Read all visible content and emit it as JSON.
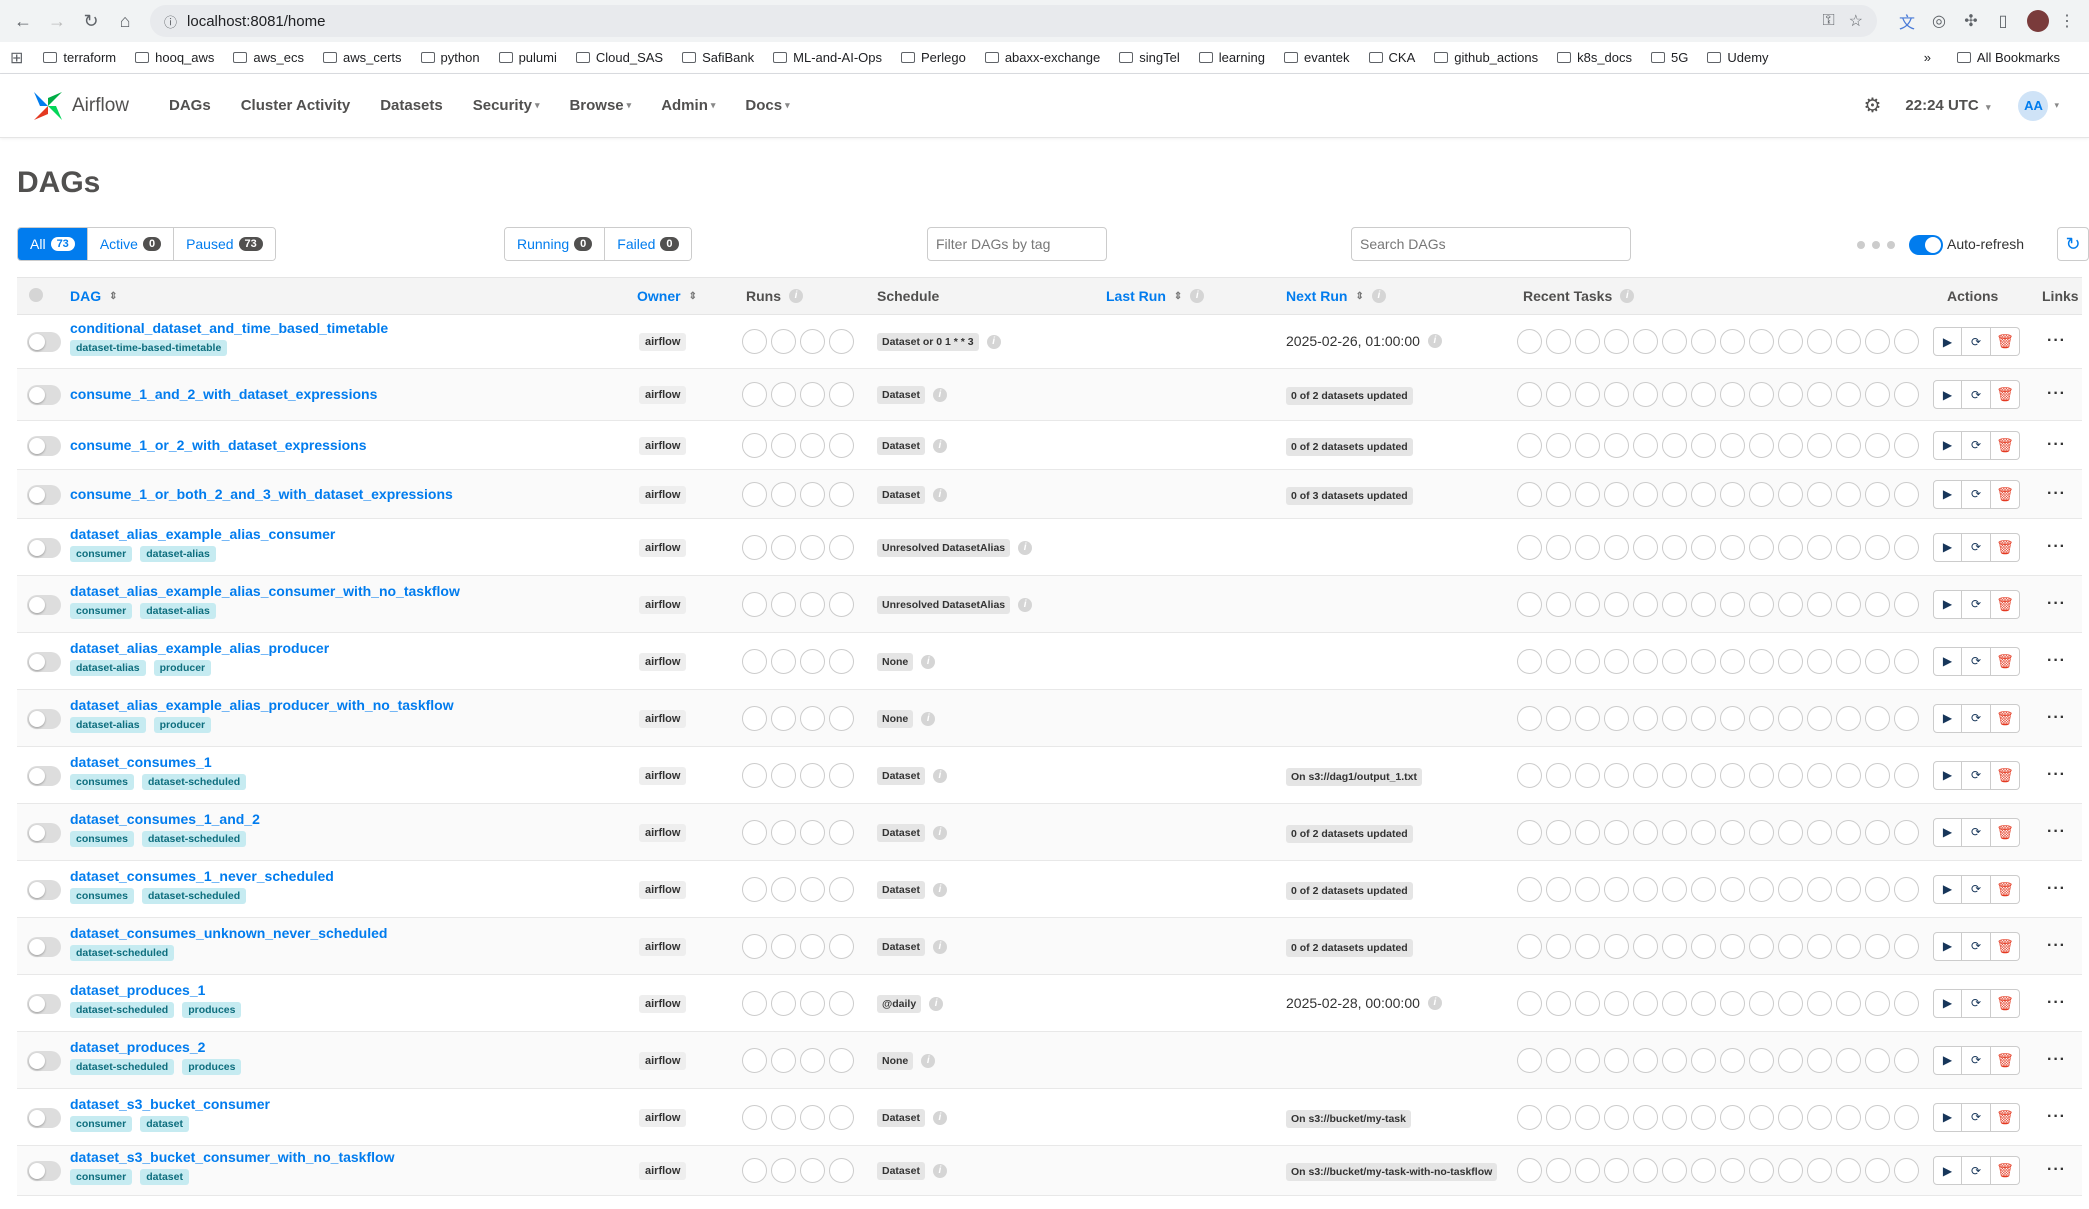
{
  "browser": {
    "url": "localhost:8081/home",
    "bookmarks": [
      "terraform",
      "hooq_aws",
      "aws_ecs",
      "aws_certs",
      "python",
      "pulumi",
      "Cloud_SAS",
      "SafiBank",
      "ML-and-AI-Ops",
      "Perlego",
      "abaxx-exchange",
      "singTel",
      "learning",
      "evantek",
      "CKA",
      "github_actions",
      "k8s_docs",
      "5G",
      "Udemy"
    ],
    "all_bookmarks": "All Bookmarks"
  },
  "nav": {
    "logo_text": "Airflow",
    "items": [
      {
        "label": "DAGs",
        "dropdown": false
      },
      {
        "label": "Cluster Activity",
        "dropdown": false
      },
      {
        "label": "Datasets",
        "dropdown": false
      },
      {
        "label": "Security",
        "dropdown": true
      },
      {
        "label": "Browse",
        "dropdown": true
      },
      {
        "label": "Admin",
        "dropdown": true
      },
      {
        "label": "Docs",
        "dropdown": true
      }
    ],
    "time": "22:24 UTC",
    "avatar": "AA"
  },
  "page": {
    "title": "DAGs",
    "status_filters": [
      {
        "label": "All",
        "count": "73",
        "active": true
      },
      {
        "label": "Active",
        "count": "0",
        "active": false
      },
      {
        "label": "Paused",
        "count": "73",
        "active": false
      }
    ],
    "run_filters": [
      {
        "label": "Running",
        "count": "0"
      },
      {
        "label": "Failed",
        "count": "0"
      }
    ],
    "tag_filter_placeholder": "Filter DAGs by tag",
    "search_placeholder": "Search DAGs",
    "auto_refresh_label": "Auto-refresh"
  },
  "columns": {
    "dag": "DAG",
    "owner": "Owner",
    "runs": "Runs",
    "schedule": "Schedule",
    "last_run": "Last Run",
    "next_run": "Next Run",
    "recent_tasks": "Recent Tasks",
    "actions": "Actions",
    "links": "Links"
  },
  "rows": [
    {
      "name": "conditional_dataset_and_time_based_timetable",
      "tags": [
        "dataset-time-based-timetable"
      ],
      "owner": "airflow",
      "schedule": "Dataset or 0 1 * * 3",
      "next_run": "2025-02-26, 01:00:00",
      "next_run_type": "text"
    },
    {
      "name": "consume_1_and_2_with_dataset_expressions",
      "tags": [],
      "owner": "airflow",
      "schedule": "Dataset",
      "next_run": "0 of 2 datasets updated",
      "next_run_type": "pill"
    },
    {
      "name": "consume_1_or_2_with_dataset_expressions",
      "tags": [],
      "owner": "airflow",
      "schedule": "Dataset",
      "next_run": "0 of 2 datasets updated",
      "next_run_type": "pill"
    },
    {
      "name": "consume_1_or_both_2_and_3_with_dataset_expressions",
      "tags": [],
      "owner": "airflow",
      "schedule": "Dataset",
      "next_run": "0 of 3 datasets updated",
      "next_run_type": "pill"
    },
    {
      "name": "dataset_alias_example_alias_consumer",
      "tags": [
        "consumer",
        "dataset-alias"
      ],
      "owner": "airflow",
      "schedule": "Unresolved DatasetAlias",
      "next_run": "",
      "next_run_type": "none"
    },
    {
      "name": "dataset_alias_example_alias_consumer_with_no_taskflow",
      "tags": [
        "consumer",
        "dataset-alias"
      ],
      "owner": "airflow",
      "schedule": "Unresolved DatasetAlias",
      "next_run": "",
      "next_run_type": "none"
    },
    {
      "name": "dataset_alias_example_alias_producer",
      "tags": [
        "dataset-alias",
        "producer"
      ],
      "owner": "airflow",
      "schedule": "None",
      "next_run": "",
      "next_run_type": "none"
    },
    {
      "name": "dataset_alias_example_alias_producer_with_no_taskflow",
      "tags": [
        "dataset-alias",
        "producer"
      ],
      "owner": "airflow",
      "schedule": "None",
      "next_run": "",
      "next_run_type": "none"
    },
    {
      "name": "dataset_consumes_1",
      "tags": [
        "consumes",
        "dataset-scheduled"
      ],
      "owner": "airflow",
      "schedule": "Dataset",
      "next_run": "On s3://dag1/output_1.txt",
      "next_run_type": "pill"
    },
    {
      "name": "dataset_consumes_1_and_2",
      "tags": [
        "consumes",
        "dataset-scheduled"
      ],
      "owner": "airflow",
      "schedule": "Dataset",
      "next_run": "0 of 2 datasets updated",
      "next_run_type": "pill"
    },
    {
      "name": "dataset_consumes_1_never_scheduled",
      "tags": [
        "consumes",
        "dataset-scheduled"
      ],
      "owner": "airflow",
      "schedule": "Dataset",
      "next_run": "0 of 2 datasets updated",
      "next_run_type": "pill"
    },
    {
      "name": "dataset_consumes_unknown_never_scheduled",
      "tags": [
        "dataset-scheduled"
      ],
      "owner": "airflow",
      "schedule": "Dataset",
      "next_run": "0 of 2 datasets updated",
      "next_run_type": "pill"
    },
    {
      "name": "dataset_produces_1",
      "tags": [
        "dataset-scheduled",
        "produces"
      ],
      "owner": "airflow",
      "schedule": "@daily",
      "next_run": "2025-02-28, 00:00:00",
      "next_run_type": "text"
    },
    {
      "name": "dataset_produces_2",
      "tags": [
        "dataset-scheduled",
        "produces"
      ],
      "owner": "airflow",
      "schedule": "None",
      "next_run": "",
      "next_run_type": "none"
    },
    {
      "name": "dataset_s3_bucket_consumer",
      "tags": [
        "consumer",
        "dataset"
      ],
      "owner": "airflow",
      "schedule": "Dataset",
      "next_run": "On s3://bucket/my-task",
      "next_run_type": "pill"
    },
    {
      "name": "dataset_s3_bucket_consumer_with_no_taskflow",
      "tags": [
        "consumer",
        "dataset"
      ],
      "owner": "airflow",
      "schedule": "Dataset",
      "next_run": "On s3://bucket/my-task-with-no-taskflow",
      "next_run_type": "pill"
    }
  ],
  "colors": {
    "accent": "#017cee",
    "tag_bg": "#c6ebf1",
    "delete": "#e43921"
  },
  "icons": {
    "play": "play-icon",
    "refresh": "refresh-icon",
    "delete": "trash-icon",
    "more": "more-icon"
  }
}
